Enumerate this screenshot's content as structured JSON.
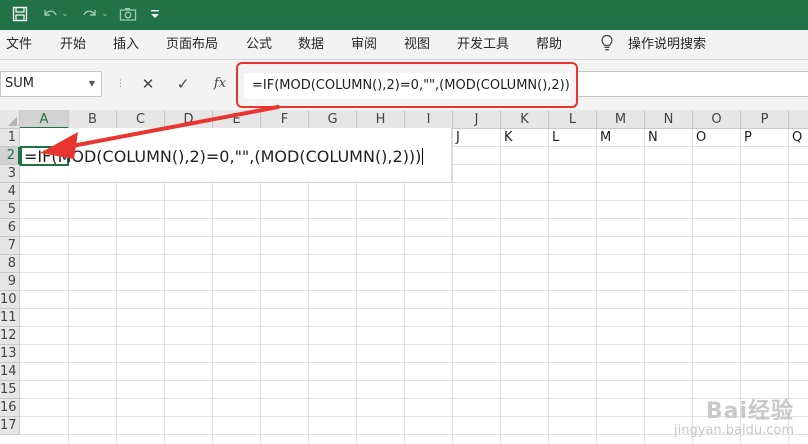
{
  "quick_access": {
    "save_icon": "save-icon",
    "undo_icon": "undo-icon",
    "redo_icon": "redo-icon",
    "camera_icon": "camera-icon",
    "customize_icon": "customize-icon"
  },
  "ribbon": {
    "tabs": [
      "文件",
      "开始",
      "插入",
      "页面布局",
      "公式",
      "数据",
      "审阅",
      "视图",
      "开发工具",
      "帮助"
    ],
    "tell_me_icon": "lightbulb-icon",
    "tell_me_label": "操作说明搜索"
  },
  "formula_bar": {
    "name_box_value": "SUM",
    "cancel_glyph": "✕",
    "enter_glyph": "✓",
    "fx_label": "fx",
    "formula": "=IF(MOD(COLUMN(),2)=0,\"\",(MOD(COLUMN(),2)))"
  },
  "sheet": {
    "columns": [
      "A",
      "B",
      "C",
      "D",
      "E",
      "F",
      "G",
      "H",
      "I",
      "J",
      "K",
      "L",
      "M",
      "N",
      "O",
      "P",
      "Q"
    ],
    "rows": [
      "1",
      "2",
      "3",
      "4",
      "5",
      "6",
      "7",
      "8",
      "9",
      "10",
      "11",
      "12",
      "13",
      "14",
      "15",
      "16",
      "17"
    ],
    "selected_column": "A",
    "selected_row": "2",
    "active_cell_text": "=IF(MOD(COLUMN(),2)=0,\"\",(MOD(COLUMN(),2)))",
    "inline_column_labels": [
      "J",
      "K",
      "L",
      "M",
      "N",
      "O",
      "P",
      "Q"
    ]
  },
  "annotation": {
    "highlight_color": "#e8352e",
    "arrow_color": "#e8352e"
  },
  "watermark": {
    "main": "Bai经验",
    "sub": "jingyan.baidu.com"
  }
}
